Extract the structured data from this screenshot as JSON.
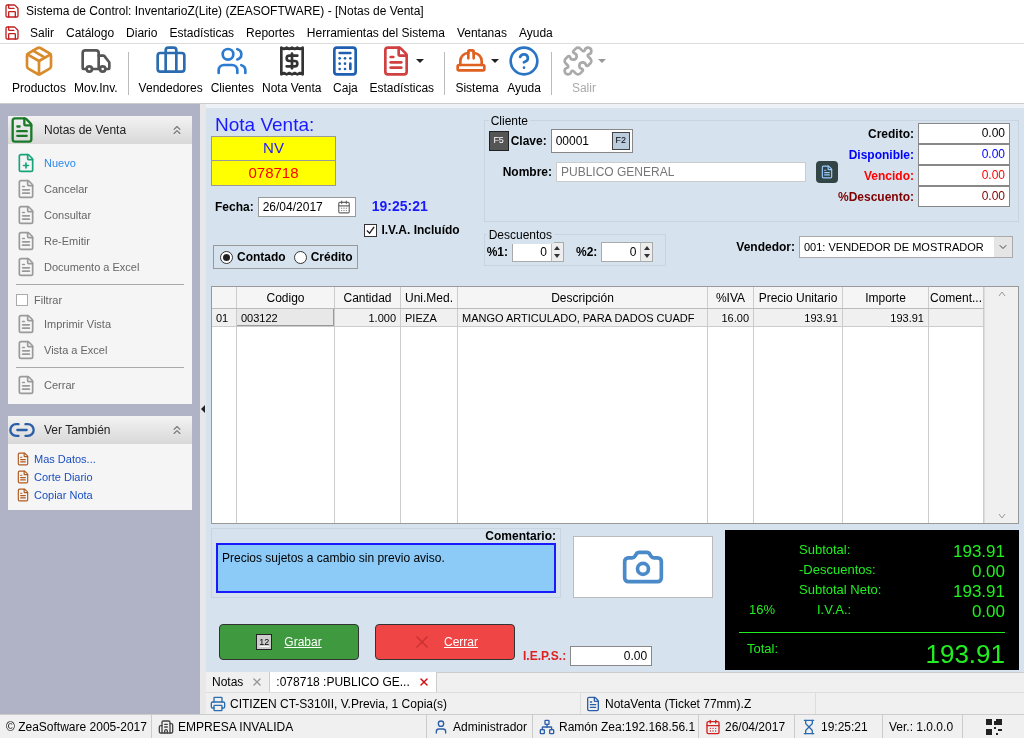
{
  "window": {
    "title": "Sistema de Control: InventarioZ(Lite) (ZEASOFTWARE) - [Notas de Venta]"
  },
  "menu": [
    "Salir",
    "Catálogo",
    "Diario",
    "Estadísticas",
    "Reportes",
    "Herramientas del Sistema",
    "Ventanas",
    "Ayuda"
  ],
  "toolbar": [
    {
      "label": "Productos",
      "kind": "products",
      "disabled": false,
      "dropdown": false
    },
    {
      "label": "Mov.Inv.",
      "kind": "forklift",
      "disabled": false,
      "dropdown": false
    },
    {
      "kind": "separator"
    },
    {
      "label": "Vendedores",
      "kind": "sellers",
      "disabled": false,
      "dropdown": false
    },
    {
      "label": "Clientes",
      "kind": "clients",
      "disabled": false,
      "dropdown": false
    },
    {
      "label": "Nota Venta",
      "kind": "register",
      "disabled": false,
      "dropdown": false
    },
    {
      "label": "Caja",
      "kind": "cashbox",
      "disabled": false,
      "dropdown": false
    },
    {
      "label": "Estadísticas",
      "kind": "stats",
      "disabled": false,
      "dropdown": true
    },
    {
      "kind": "separator"
    },
    {
      "label": "Sistema",
      "kind": "worker",
      "disabled": false,
      "dropdown": true
    },
    {
      "label": "Ayuda",
      "kind": "help",
      "disabled": false,
      "dropdown": false
    },
    {
      "kind": "separator"
    },
    {
      "label": "Salir",
      "kind": "puzzle",
      "disabled": true,
      "dropdown": true
    }
  ],
  "sidebar": {
    "panels": [
      {
        "title": "Notas de Venta",
        "kind": "notes",
        "groups": [
          [
            {
              "label": "Nuevo",
              "kind": "new",
              "disabled": false
            },
            {
              "label": "Cancelar",
              "kind": "action",
              "disabled": true
            },
            {
              "label": "Consultar",
              "kind": "action",
              "disabled": true
            },
            {
              "label": "Re-Emitir",
              "kind": "action",
              "disabled": true
            },
            {
              "label": "Documento a Excel",
              "kind": "action",
              "disabled": true
            }
          ],
          [
            {
              "label": "Filtrar",
              "kind": "checkbox",
              "checked": false,
              "disabled": true
            },
            {
              "label": "Imprimir Vista",
              "kind": "action",
              "disabled": true
            },
            {
              "label": "Vista a Excel",
              "kind": "action",
              "disabled": true
            }
          ],
          [
            {
              "label": "Cerrar",
              "kind": "exit",
              "disabled": true
            }
          ]
        ]
      },
      {
        "title": "Ver También",
        "kind": "see",
        "groups": [
          [
            {
              "label": "Mas Datos...",
              "kind": "link",
              "disabled": false
            },
            {
              "label": "Corte Diario",
              "kind": "link",
              "disabled": false
            },
            {
              "label": "Copiar Nota",
              "kind": "link",
              "disabled": false
            }
          ]
        ]
      }
    ]
  },
  "form": {
    "title": "Nota Venta:",
    "serie": "NV",
    "folio": "078718",
    "fecha_label": "Fecha:",
    "fecha": "26/04/2017",
    "hora": "19:25:21",
    "iva": {
      "label": "I.V.A. Incluído",
      "checked": true
    },
    "payment": [
      {
        "label": "Contado",
        "selected": true
      },
      {
        "label": "Crédito",
        "selected": false
      }
    ]
  },
  "cliente": {
    "title": "Cliente",
    "f5": "F5",
    "clave_label": "Clave:",
    "clave": "00001",
    "f2": "F2",
    "nombre_label": "Nombre:",
    "nombre": "PUBLICO GENERAL",
    "accounts": [
      {
        "label": "Credito:",
        "value": "0.00",
        "color": "#000000"
      },
      {
        "label": "Disponible:",
        "value": "0.00",
        "color": "#0000ff"
      },
      {
        "label": "Vencido:",
        "value": "0.00",
        "color": "#ff0000"
      },
      {
        "label": "%Descuento:",
        "value": "0.00",
        "color": "#800000"
      }
    ]
  },
  "descuentos": {
    "title": "Descuentos",
    "fields": [
      {
        "label": "%1:",
        "value": "0"
      },
      {
        "label": "%2:",
        "value": "0"
      }
    ]
  },
  "vendedor": {
    "label": "Vendedor:",
    "value": "001: VENDEDOR DE MOSTRADOR"
  },
  "table": {
    "columns": [
      "Codigo",
      "Cantidad",
      "Uni.Med.",
      "Descripción",
      "%IVA",
      "Precio Unitario",
      "Importe",
      "Coment..."
    ],
    "rows": [
      {
        "number": "01",
        "cells": [
          "003122",
          "1.000",
          "PIEZA",
          "MANGO ARTICULADO, PARA DADOS CUADF",
          "16.00",
          "193.91",
          "193.91",
          null
        ]
      }
    ]
  },
  "comentario": {
    "label": "Comentario:",
    "value": "Precios sujetos a cambio sin previo aviso."
  },
  "buttons": [
    {
      "label": "Grabar",
      "kind": "save",
      "key": "12"
    },
    {
      "label": "Cerrar",
      "kind": "close"
    }
  ],
  "ieps": {
    "label": "I.E.P.S.:",
    "value": "0.00"
  },
  "totals": {
    "rows": [
      {
        "label": "Subtotal:",
        "value": "193.91"
      },
      {
        "label": "-Descuentos:",
        "value": "0.00"
      },
      {
        "label": "Subtotal Neto:",
        "value": "193.91"
      },
      {
        "rate": "16%",
        "label": "I.V.A.:",
        "value": "0.00"
      }
    ],
    "total_label": "Total:",
    "total": "193.91"
  },
  "tabs": [
    {
      "label": "Notas",
      "selected": false,
      "color": "#999999"
    },
    {
      "label": ":078718 :PUBLICO GE...",
      "selected": true,
      "color": "#d01010"
    }
  ],
  "printer_bar": [
    {
      "kind": "printer",
      "text": "CITIZEN CT-S310II, V.Previa, 1 Copia(s)"
    },
    {
      "kind": "report",
      "text": "NotaVenta (Ticket 77mm).Z"
    }
  ],
  "status_bar": [
    {
      "kind": "copyright",
      "text": "© ZeaSoftware 2005-2017"
    },
    {
      "kind": "company",
      "text": "EMPRESA INVALIDA"
    },
    {
      "kind": "user",
      "text": "Administrador"
    },
    {
      "kind": "network",
      "text": "Ramón Zea:192.168.56.1"
    },
    {
      "kind": "date",
      "text": "26/04/2017"
    },
    {
      "kind": "time",
      "text": "19:25:21"
    },
    {
      "kind": "version",
      "text": "Ver.: 1.0.0.0"
    },
    {
      "kind": "qr"
    }
  ]
}
